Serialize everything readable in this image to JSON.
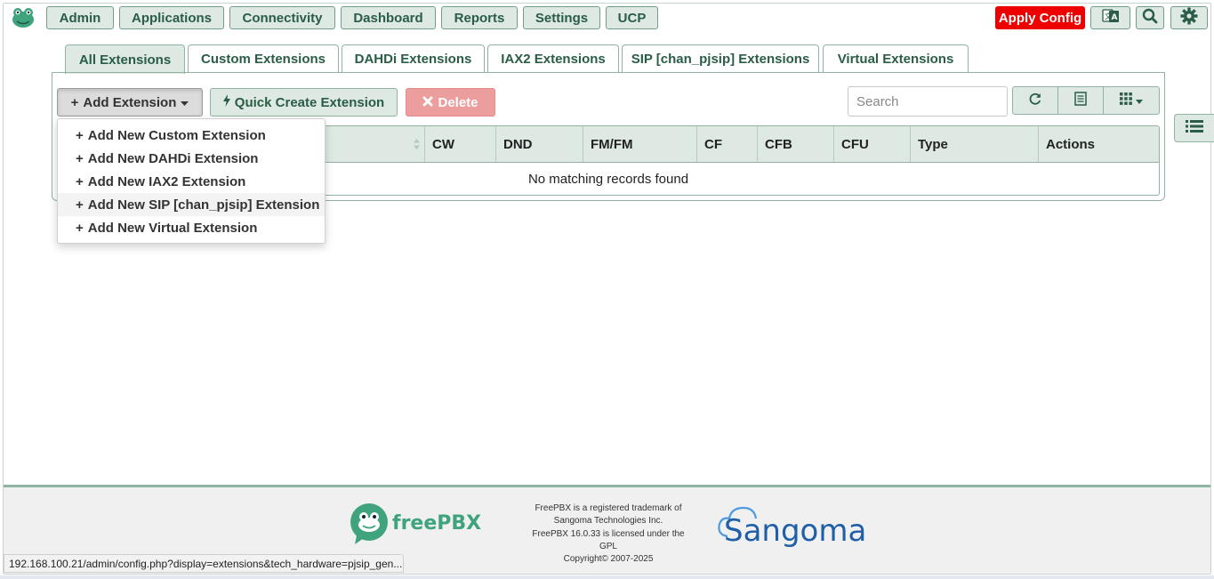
{
  "nav": {
    "items": [
      "Admin",
      "Applications",
      "Connectivity",
      "Dashboard",
      "Reports",
      "Settings",
      "UCP"
    ],
    "apply_config": "Apply Config",
    "icons": [
      "language-icon",
      "search-icon",
      "gear-icon"
    ]
  },
  "tabs": [
    "All Extensions",
    "Custom Extensions",
    "DAHDi Extensions",
    "IAX2 Extensions",
    "SIP [chan_pjsip] Extensions",
    "Virtual Extensions"
  ],
  "active_tab": "All Extensions",
  "toolbar": {
    "add_label": "Add Extension",
    "quick_label": "Quick Create Extension",
    "delete_label": "Delete",
    "search_placeholder": "Search"
  },
  "dropdown": {
    "items": [
      "Add New Custom Extension",
      "Add New DAHDi Extension",
      "Add New IAX2 Extension",
      "Add New SIP [chan_pjsip] Extension",
      "Add New Virtual Extension"
    ],
    "highlighted": "Add New SIP [chan_pjsip] Extension"
  },
  "table": {
    "columns": [
      "CW",
      "DND",
      "FM/FM",
      "CF",
      "CFB",
      "CFU",
      "Type",
      "Actions"
    ],
    "empty_message": "No matching records found"
  },
  "footer": {
    "brand": "freePBX",
    "lines": [
      "FreePBX is a registered trademark of",
      "Sangoma Technologies Inc.",
      "FreePBX 16.0.33 is licensed under the",
      "GPL",
      "Copyright© 2007-2025"
    ],
    "company": "Sangoma"
  },
  "status_url": "192.168.100.21/admin/config.php?display=extensions&tech_hardware=pjsip_gen...",
  "colors": {
    "accent": "#2a5d48",
    "button_bg": "#dde9e2",
    "border": "#8fb4a1",
    "apply": "#ee0000",
    "delete": "#ec9d9d",
    "brand_green": "#3fa37d",
    "sangoma_blue": "#1f5fa8"
  }
}
